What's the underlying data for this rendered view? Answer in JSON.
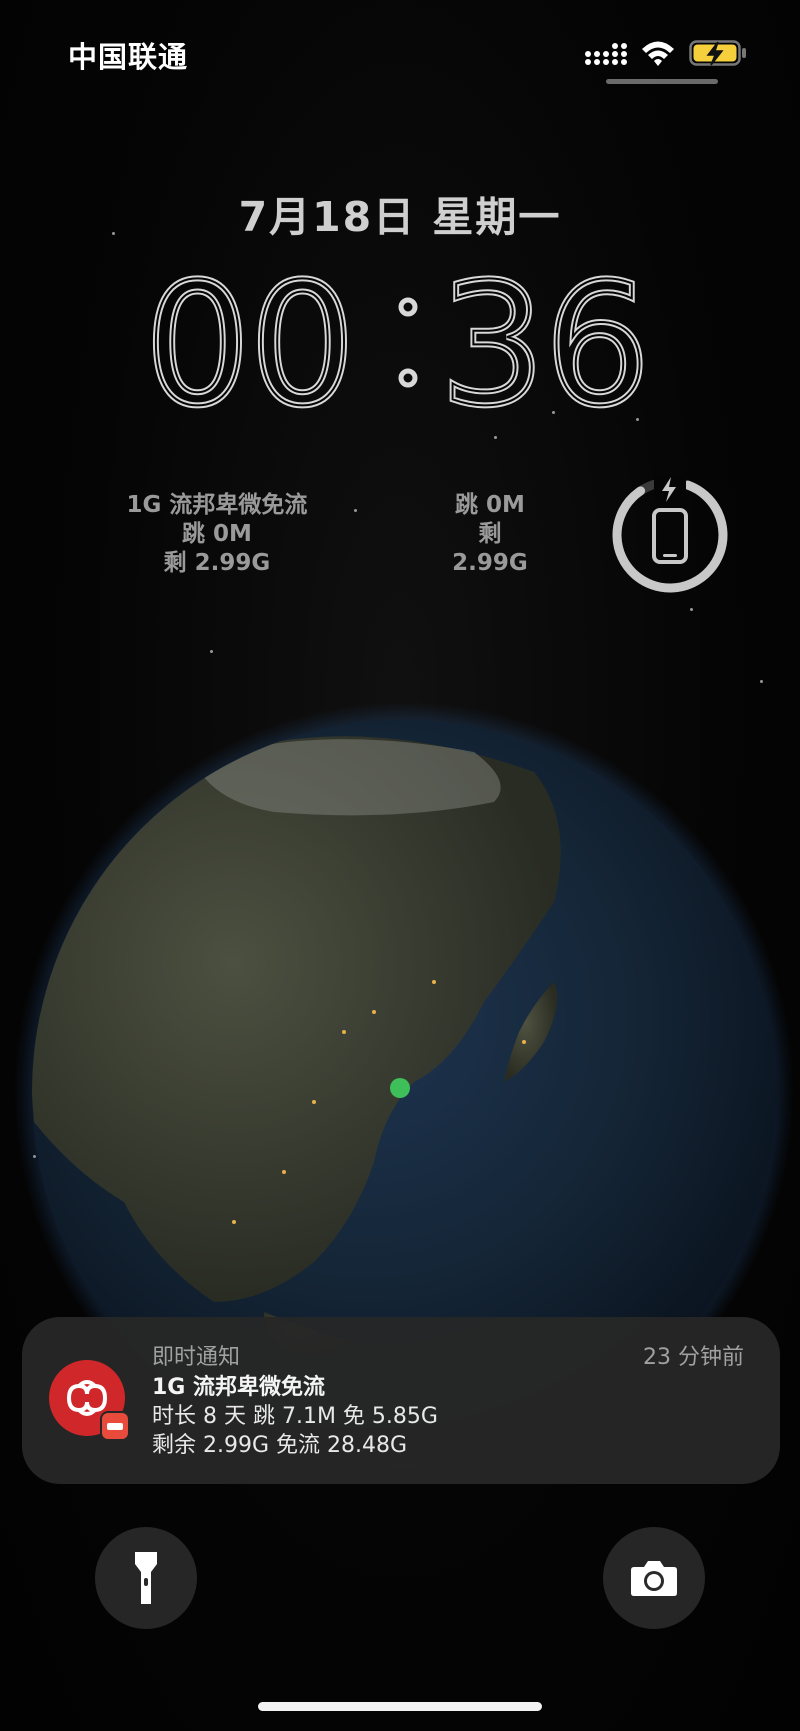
{
  "status_bar": {
    "carrier": "中国联通",
    "icons": [
      "cellular-signal-icon",
      "wifi-icon",
      "battery-charging-icon"
    ]
  },
  "lock_screen": {
    "date": "7月18日 星期一",
    "time_hours": "00",
    "time_minutes": "36"
  },
  "widgets": {
    "left": {
      "line1": "1G 流邦卑微免流",
      "line2": "跳 0M",
      "line3": "剩 2.99G"
    },
    "middle": {
      "line1": "跳 0M",
      "line2": "剩",
      "line3": "2.99G"
    },
    "battery": {
      "icon": "phone-charging-icon",
      "level_fraction": 0.85
    }
  },
  "wallpaper": {
    "subject": "earth-globe",
    "location_dot_color": "#3fbf5a"
  },
  "notification": {
    "app_name": "即时通知",
    "time": "23 分钟前",
    "title": "1G 流邦卑微免流",
    "line1": "时长 8 天 跳 7.1M 免 5.85G",
    "line2": "剩余 2.99G 免流 28.48G",
    "app_icon": "china-unicom-logo-icon",
    "badge_icon": "app-badge-icon",
    "accent_color": "#d0282a"
  },
  "quick_actions": {
    "left_icon": "flashlight-icon",
    "right_icon": "camera-icon"
  },
  "colors": {
    "battery_fill": "#f5cf3c",
    "ring_color": "#c8c8c8"
  }
}
